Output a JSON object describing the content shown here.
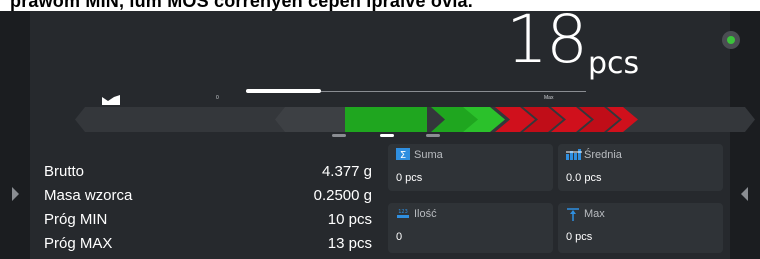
{
  "caption": {
    "text": "prawom MIN, lum MOS correnyen cepen ipraive ovia."
  },
  "display": {
    "weight_value": "18",
    "weight_unit": "pcs",
    "status_color": "#3cc23c"
  },
  "bargraph": {
    "min_label": "0",
    "max_label": "Max",
    "fill_fraction": 0.22
  },
  "info": {
    "rows": [
      {
        "label": "Brutto",
        "value": "4.377  g"
      },
      {
        "label": "Masa wzorca",
        "value": "0.2500 g"
      },
      {
        "label": "Próg MIN",
        "value": "10 pcs"
      },
      {
        "label": "Próg MAX",
        "value": "13 pcs"
      }
    ]
  },
  "stats": {
    "suma": {
      "title": "Suma",
      "value": "0 pcs",
      "icon": "sum-icon"
    },
    "srednia": {
      "title": "Średnia",
      "value": "0.0 pcs",
      "icon": "average-icon"
    },
    "ilosc": {
      "title": "Ilość",
      "value": "0",
      "icon": "count-icon"
    },
    "max": {
      "title": "Max",
      "value": "0 pcs",
      "icon": "max-arrow-icon"
    }
  },
  "colors": {
    "accent_blue": "#2f8fe0",
    "ok_green": "#1faa1f",
    "over_red": "#d0101c"
  }
}
